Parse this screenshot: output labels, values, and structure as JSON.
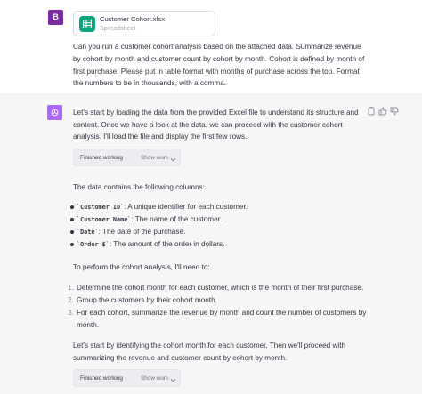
{
  "user": {
    "avatar_letter": "B",
    "attachment": {
      "name": "Customer Cohort.xlsx",
      "type": "Spreadsheet"
    },
    "message": "Can you run a customer cohort analysis based on the attached data. Summarize revenue by cohort by month and customer count by cohort by month. Cohort is defined by month of first purchase. Please put in table format with months of purchase across the top. Format the numbers to be in thousands, with a comma."
  },
  "assistant": {
    "intro": "Let's start by loading the data from the provided Excel file to understand its structure and content. Once we have a look at the data, we can proceed with the customer cohort analysis. I'll load the file and display the first few rows.",
    "working_1": {
      "label": "Finished working",
      "toggle": "Show work"
    },
    "columns_intro": "The data contains the following columns:",
    "columns": [
      {
        "code": "`Customer ID`",
        "desc": ": A unique identifier for each customer."
      },
      {
        "code": "`Customer Name`",
        "desc": ": The name of the customer."
      },
      {
        "code": "`Date`",
        "desc": ": The date of the purchase."
      },
      {
        "code": "`Order $`",
        "desc": ": The amount of the order in dollars."
      }
    ],
    "steps_intro": "To perform the cohort analysis, I'll need to:",
    "steps": [
      {
        "num": "1.",
        "text": "Determine the cohort month for each customer, which is the month of their first purchase."
      },
      {
        "num": "2.",
        "text": "Group the customers by their cohort month."
      },
      {
        "num": "3.",
        "text_line1": "For each cohort, summarize the revenue by month and count the number of customers by",
        "text_line2": "month."
      }
    ],
    "outro": "Let's start by identifying the cohort month for each customer. Then we'll proceed with summarizing the revenue and customer count by cohort by month.",
    "working_2": {
      "label": "Finished working",
      "toggle": "Show work"
    }
  },
  "icons": {
    "spreadsheet": "spreadsheet-icon",
    "assistant_logo": "openai-logo-icon",
    "copy": "copy-icon",
    "thumbs_up": "thumbs-up-icon",
    "thumbs_down": "thumbs-down-icon",
    "chevron": "chevron-down-icon"
  },
  "colors": {
    "user_avatar": "#7b2ca3",
    "assistant_avatar": "#ab68ff",
    "spreadsheet": "#10a37f",
    "assistant_bg": "#f7f7f8"
  }
}
